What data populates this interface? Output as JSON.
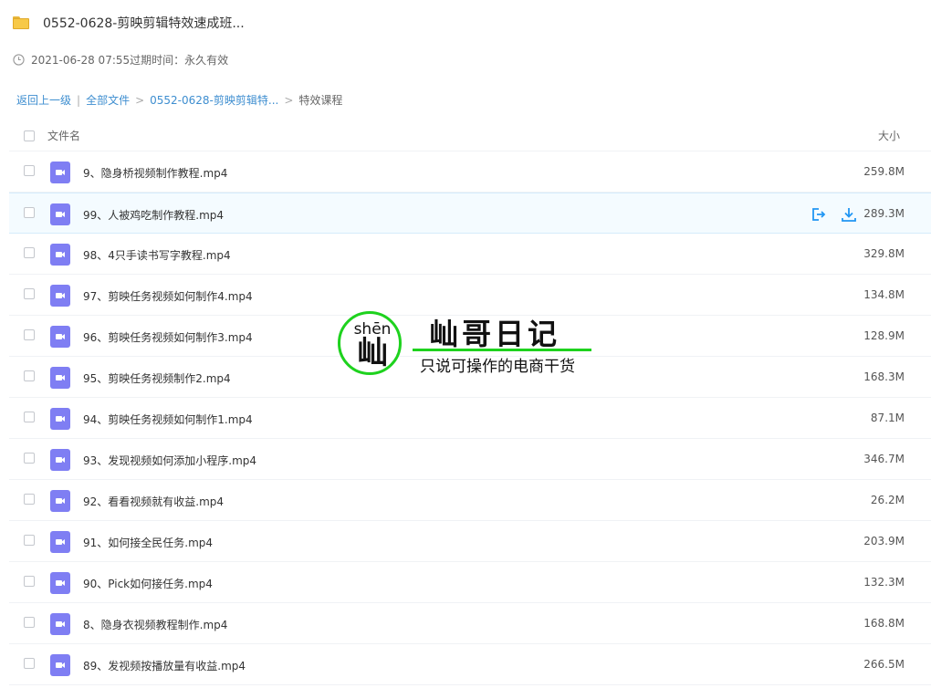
{
  "header": {
    "title": "0552-0628-剪映剪辑特效速成班...",
    "icon": "folder-icon"
  },
  "meta": {
    "text": "2021-06-28 07:55过期时间：永久有效",
    "icon": "clock-icon"
  },
  "breadcrumb": {
    "back": "返回上一级",
    "sep1": "|",
    "all": "全部文件",
    "arrow": ">",
    "parent": "0552-0628-剪映剪辑特...",
    "current": "特效课程"
  },
  "columns": {
    "name": "文件名",
    "size": "大小"
  },
  "files": [
    {
      "name": "9、隐身桥视频制作教程.mp4",
      "size": "259.8M"
    },
    {
      "name": "99、人被鸡吃制作教程.mp4",
      "size": "289.3M"
    },
    {
      "name": "98、4只手读书写字教程.mp4",
      "size": "329.8M"
    },
    {
      "name": "97、剪映任务视频如何制作4.mp4",
      "size": "134.8M"
    },
    {
      "name": "96、剪映任务视频如何制作3.mp4",
      "size": "128.9M"
    },
    {
      "name": "95、剪映任务视频制作2.mp4",
      "size": "168.3M"
    },
    {
      "name": "94、剪映任务视频如何制作1.mp4",
      "size": "87.1M"
    },
    {
      "name": "93、发现视频如何添加小程序.mp4",
      "size": "346.7M"
    },
    {
      "name": "92、看看视频就有收益.mp4",
      "size": "26.2M"
    },
    {
      "name": "91、如何接全民任务.mp4",
      "size": "203.9M"
    },
    {
      "name": "90、Pick如何接任务.mp4",
      "size": "132.3M"
    },
    {
      "name": "8、隐身衣视频教程制作.mp4",
      "size": "168.8M"
    },
    {
      "name": "89、发视频按播放量有收益.mp4",
      "size": "266.5M"
    }
  ],
  "hover_row_index": 1,
  "hover_actions": [
    "share-icon",
    "download-icon"
  ],
  "watermark": {
    "pinyin": "shēn",
    "char": "屾",
    "title": "屾哥日记",
    "subtitle": "只说可操作的电商干货"
  },
  "colors": {
    "accent": "#3e8ed0",
    "video_icon": "#7f7ef3",
    "hover_bg": "#f4fbff",
    "watermark_green": "#1ed21e"
  }
}
